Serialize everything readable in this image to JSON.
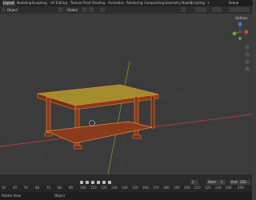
{
  "workspace_tabs": [
    "Layout",
    "Modeling",
    "Sculpting",
    "UV Editing",
    "Texture Paint",
    "Shading",
    "Animation",
    "Rendering",
    "Compositing",
    "Geometry Nodes",
    "Scripting",
    "+"
  ],
  "scene_name": "Scene",
  "header": {
    "mode": "Object",
    "global": "Global",
    "options": "Options"
  },
  "timeline": {
    "current_frame": "1",
    "start_label": "Start",
    "start_value": "1",
    "end_label": "End",
    "end_value": "250"
  },
  "ruler_ticks": [
    "50",
    "40",
    "50",
    "60",
    "70",
    "80",
    "90",
    "100",
    "110",
    "120",
    "130",
    "140",
    "150",
    "160",
    "170",
    "180",
    "190",
    "200",
    "210",
    "220",
    "230",
    "240",
    "250"
  ],
  "status_bar": {
    "left": "Rotate View",
    "middle": "Object"
  },
  "colors": {
    "viewport_bg": "#3b3b3b",
    "selection_outline": "#e8863a",
    "table_top": "#a38c2b",
    "table_wood": "#8a3b1c",
    "x_axis": "#b23a3a",
    "y_axis": "#6f9a2a"
  }
}
